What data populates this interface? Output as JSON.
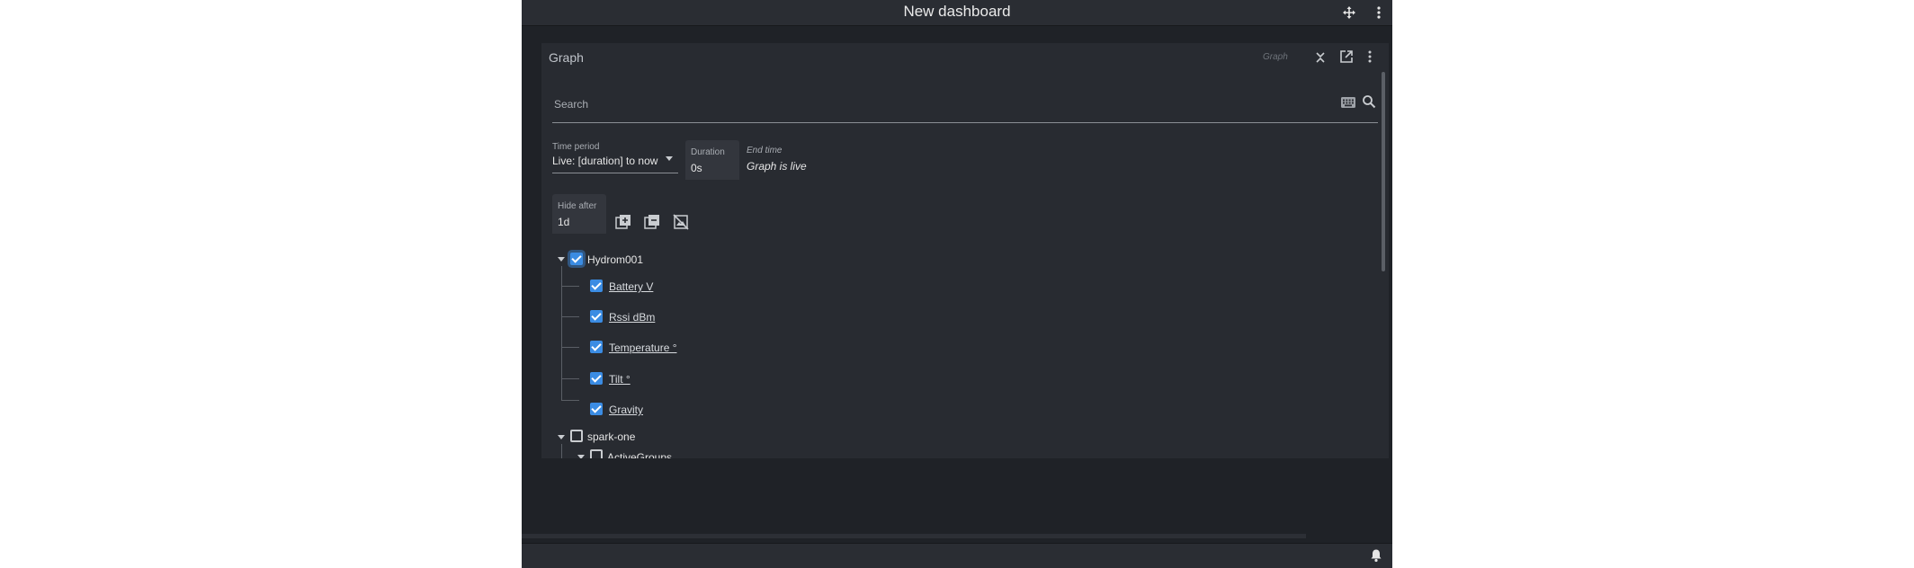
{
  "topbar": {
    "title": "New dashboard",
    "move_icon": "move-icon",
    "menu_icon": "more-vert-icon"
  },
  "widget": {
    "title": "Graph",
    "type_label": "Graph",
    "icons": [
      "collapse-icon",
      "open-in-new-icon",
      "more-vert-icon"
    ]
  },
  "search": {
    "placeholder": "Search",
    "value": "",
    "icons": [
      "keyboard-icon",
      "search-icon"
    ]
  },
  "time_period": {
    "label": "Time period",
    "value": "Live: [duration] to now"
  },
  "duration": {
    "label": "Duration",
    "value": "0s"
  },
  "end_time": {
    "label": "End time",
    "value": "Graph is live"
  },
  "hide_after": {
    "label": "Hide after",
    "value": "1d"
  },
  "toolbar_icons": [
    "library-add-icon",
    "library-remove-icon",
    "hide-image-icon"
  ],
  "tree": {
    "groups": [
      {
        "label": "Hydrom001",
        "checked": true,
        "expanded": true,
        "children": [
          {
            "label": "Battery V",
            "checked": true
          },
          {
            "label": "Rssi dBm",
            "checked": true
          },
          {
            "label": "Temperature °",
            "checked": true
          },
          {
            "label": "Tilt °",
            "checked": true
          },
          {
            "label": "Gravity",
            "checked": true
          }
        ]
      },
      {
        "label": "spark-one",
        "checked": false,
        "expanded": true,
        "children": [
          {
            "label": "ActiveGroups",
            "checked": false
          }
        ]
      }
    ]
  },
  "statusbar": {
    "bell_icon": "bell-icon"
  },
  "colors": {
    "background": "#1f2227",
    "panel": "#282b31",
    "accent": "#3b8ce3"
  }
}
